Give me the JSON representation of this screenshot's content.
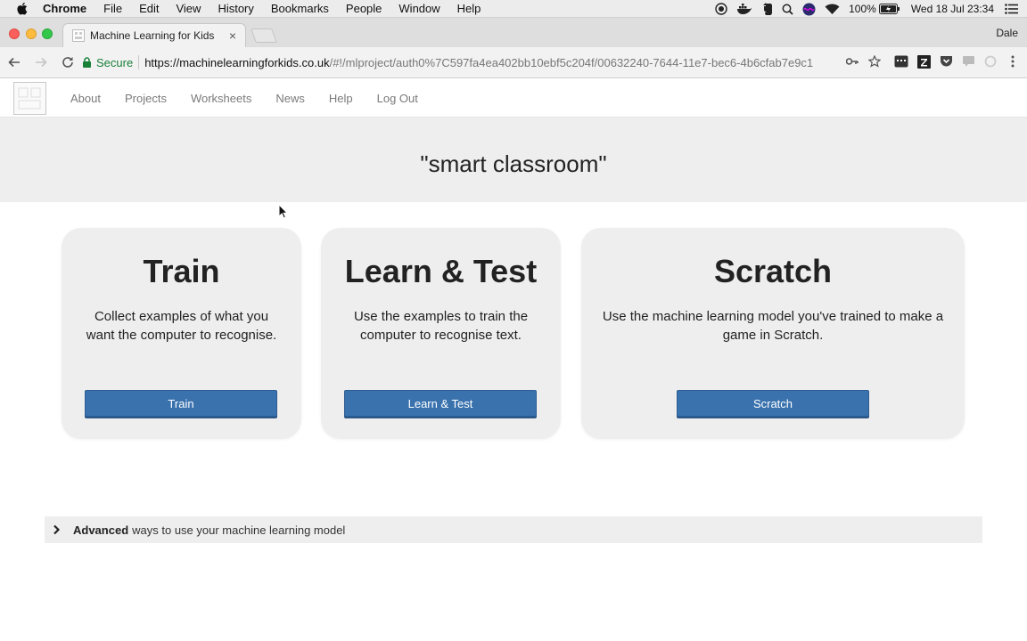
{
  "menubar": {
    "app": "Chrome",
    "items": [
      "File",
      "Edit",
      "View",
      "History",
      "Bookmarks",
      "People",
      "Window",
      "Help"
    ],
    "battery": "100%",
    "clock": "Wed 18 Jul  23:34"
  },
  "browser": {
    "tab_title": "Machine Learning for Kids",
    "tab_close": "×",
    "profile": "Dale",
    "secure_label": "Secure",
    "url_host": "https://machinelearningforkids.co.uk",
    "url_rest": "/#!/mlproject/auth0%7C597fa4ea402bb10ebf5c204f/00632240-7644-11e7-bec6-4b6cfab7e9c1"
  },
  "site": {
    "nav": [
      "About",
      "Projects",
      "Worksheets",
      "News",
      "Help",
      "Log Out"
    ],
    "project_title": "\"smart classroom\""
  },
  "cards": [
    {
      "title": "Train",
      "description": "Collect examples of what you want the computer to recognise.",
      "button": "Train"
    },
    {
      "title": "Learn & Test",
      "description": "Use the examples to train the computer to recognise text.",
      "button": "Learn & Test"
    },
    {
      "title": "Scratch",
      "description": "Use the machine learning model you've trained to make a game in Scratch.",
      "button": "Scratch"
    }
  ],
  "advanced": {
    "bold": "Advanced",
    "text": "ways to use your machine learning model"
  },
  "icons": {
    "menubar": [
      "apple-icon",
      "record-icon",
      "docker-icon",
      "evernote-icon",
      "search-icon",
      "siri-icon",
      "wifi-icon",
      "battery-icon",
      "list-icon"
    ],
    "toolbar": [
      "back-icon",
      "forward-icon",
      "reload-icon",
      "lock-icon",
      "key-icon",
      "star-icon",
      "extension-icon",
      "zotero-icon",
      "pocket-icon",
      "chat-icon",
      "sync-icon",
      "more-icon"
    ],
    "advanced": "chevron-right-icon"
  },
  "colors": {
    "button": "#3a72ae",
    "secure": "#188038",
    "card_bg": "#eeeeee"
  }
}
